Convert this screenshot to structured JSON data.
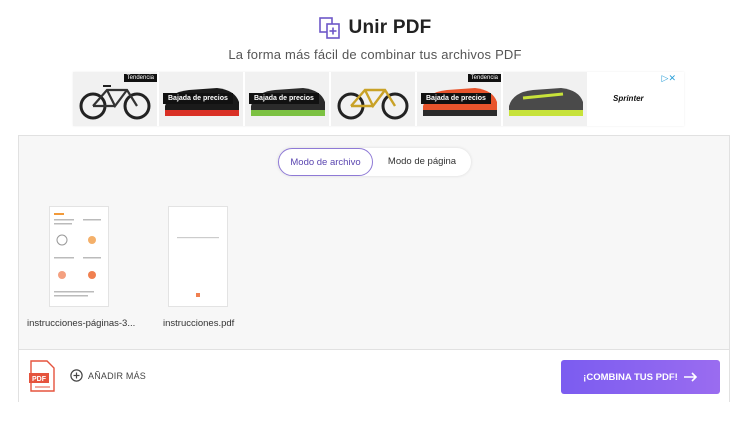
{
  "header": {
    "icon": "merge-pdf-icon",
    "title": "Unir PDF",
    "subtitle": "La forma más fácil de combinar tus archivos PDF"
  },
  "ad": {
    "tiles": [
      {
        "kind": "bike",
        "badge": "Tendencia",
        "label": ""
      },
      {
        "kind": "shoe",
        "badge": "",
        "label": "Bajada de precios"
      },
      {
        "kind": "shoe",
        "badge": "",
        "label": "Bajada de precios"
      },
      {
        "kind": "bike",
        "badge": "",
        "label": ""
      },
      {
        "kind": "shoe",
        "badge": "Tendencia",
        "label": "Bajada de precios"
      },
      {
        "kind": "shoe",
        "badge": "",
        "label": ""
      }
    ],
    "brand": "Sprinter",
    "choices": "▷✕"
  },
  "mode_toggle": {
    "active": "Modo de archivo",
    "inactive": "Modo de página"
  },
  "files": [
    {
      "name": "instrucciones-páginas-3...",
      "thumb": "multi-page"
    },
    {
      "name": "instrucciones.pdf",
      "thumb": "single-page"
    }
  ],
  "footer": {
    "pdf_icon_label": "PDF",
    "add_more": "AÑADIR MÁS",
    "combine": "¡COMBINA TUS PDF!"
  },
  "colors": {
    "accent": "#7b5cf0",
    "pdf_red": "#e5533d",
    "toggle_border": "#8f7ad6"
  }
}
